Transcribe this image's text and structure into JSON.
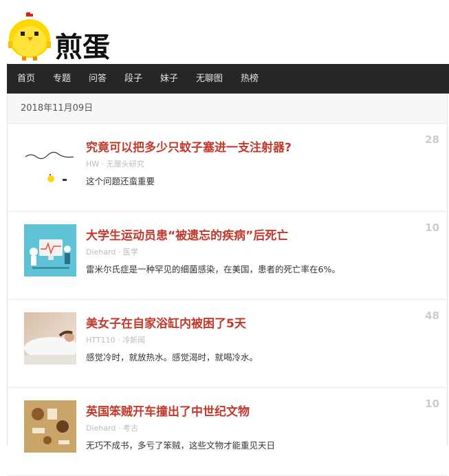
{
  "site": {
    "logo_text": "煎蛋",
    "logo_icon": "chick-icon"
  },
  "nav": {
    "items": [
      "首页",
      "专题",
      "问答",
      "段子",
      "妹子",
      "无聊图",
      "热榜"
    ]
  },
  "date": "2018年11月09日",
  "posts": [
    {
      "title": "究竟可以把多少只蚊子塞进一支注射器?",
      "author": "HW",
      "sep": " · ",
      "category": "无厘头研究",
      "excerpt": "这个问题还蛮重要",
      "count": "28",
      "thumb_icon": "doodle-chick-thumbnail"
    },
    {
      "title": "大学生运动员患“被遗忘的疾病”后死亡",
      "author": "Diehard",
      "sep": " · ",
      "category": "医学",
      "excerpt": "雷米尔氏症是一种罕见的细菌感染，在美国，患者的死亡率在6%。",
      "count": "10",
      "thumb_icon": "medical-illustration-thumbnail"
    },
    {
      "title": "美女子在自家浴缸内被困了5天",
      "author": "HTT110",
      "sep": " · ",
      "category": "冷新闻",
      "excerpt": "感觉冷时，就放热水。感觉渴时，就喝冷水。",
      "count": "48",
      "thumb_icon": "bathtub-photo-thumbnail"
    },
    {
      "title": "英国笨贼开车撞出了中世纪文物",
      "author": "Diehard",
      "sep": " · ",
      "category": "考古",
      "excerpt": "无巧不成书，多亏了笨贼，这些文物才能重见天日",
      "count": "10",
      "thumb_icon": "artifacts-illustration-thumbnail"
    }
  ],
  "colors": {
    "nav_bg": "#262626",
    "title": "#c0392b",
    "count": "#cccccc",
    "meta": "#bbbbbb"
  }
}
